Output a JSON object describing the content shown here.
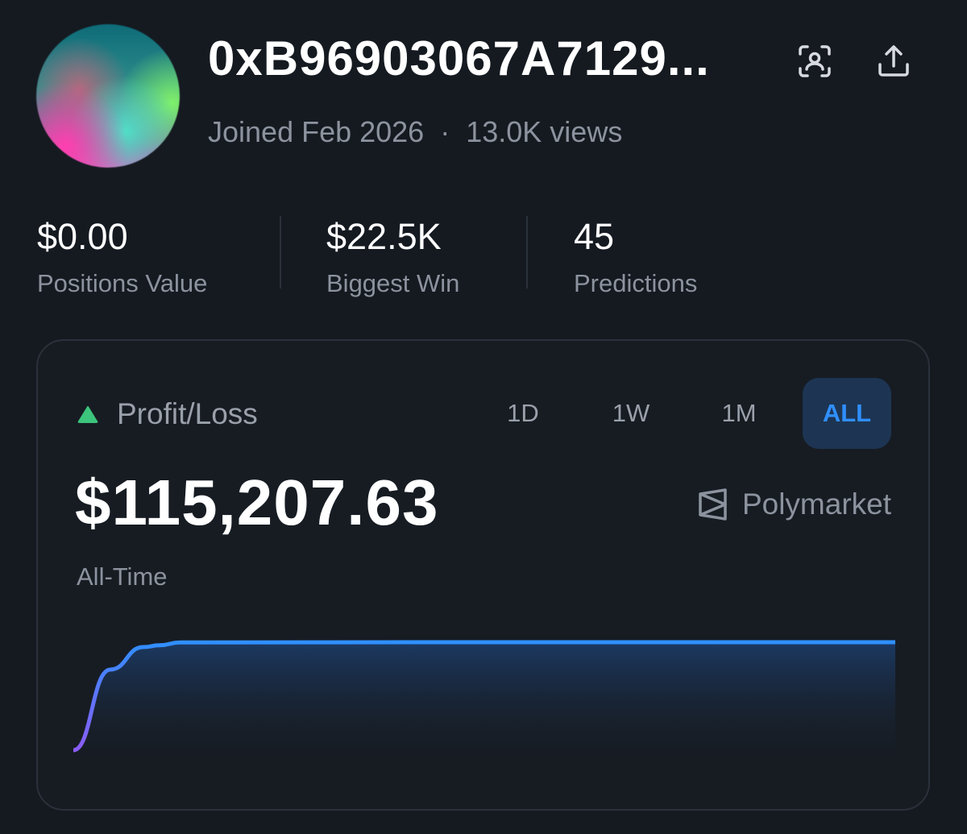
{
  "profile": {
    "address": "0xB96903067A7129...",
    "joined": "Joined Feb 2026",
    "separator": "·",
    "views": "13.0K views",
    "actions": {
      "scan_icon": "scan-person-icon",
      "share_icon": "share-upload-icon"
    }
  },
  "stats": [
    {
      "value": "$0.00",
      "label": "Positions Value"
    },
    {
      "value": "$22.5K",
      "label": "Biggest Win"
    },
    {
      "value": "45",
      "label": "Predictions"
    }
  ],
  "pnl": {
    "label": "Profit/Loss",
    "amount": "$115,207.63",
    "period": "All-Time",
    "brand": "Polymarket",
    "tabs": [
      "1D",
      "1W",
      "1M",
      "ALL"
    ],
    "active_tab": "ALL",
    "colors": {
      "accent": "#2f8fff",
      "up": "#3cc47c",
      "line_start": "#8b5cf6"
    }
  },
  "chart_data": {
    "type": "line",
    "series": [
      {
        "values": [
          0,
          86000,
          110000,
          112000,
          115000,
          115207.63,
          115207.63,
          115207.63
        ]
      }
    ]
  }
}
